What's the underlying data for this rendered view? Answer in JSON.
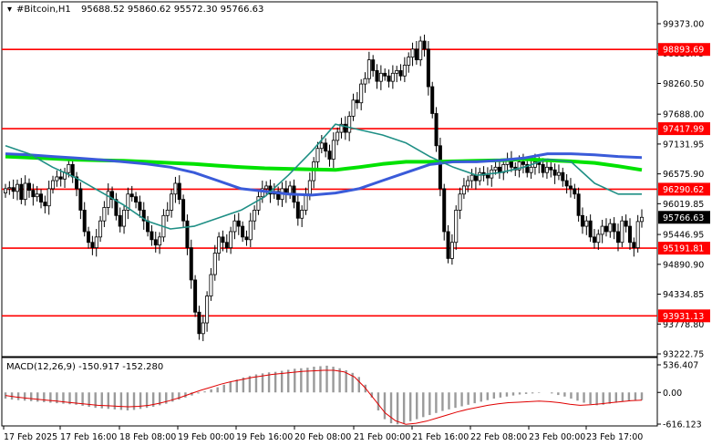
{
  "header": {
    "symbol": "#Bitcoin,H1",
    "ohlc": "95688.52 95860.62 95572.30 95766.63"
  },
  "chart_data": {
    "type": "candlestick",
    "symbol": "#Bitcoin",
    "timeframe": "H1",
    "price_axis": {
      "min": 93222.75,
      "max": 99373.0,
      "ticks": [
        99373.0,
        98816.75,
        98260.5,
        97688.0,
        97131.95,
        96575.9,
        96019.85,
        95446.95,
        94890.9,
        94334.85,
        93778.8,
        93222.75
      ]
    },
    "time_axis": {
      "labels": [
        "17 Feb 2025",
        "17 Feb 16:00",
        "18 Feb 08:00",
        "19 Feb 00:00",
        "19 Feb 16:00",
        "20 Feb 08:00",
        "21 Feb 00:00",
        "21 Feb 16:00",
        "22 Feb 08:00",
        "23 Feb 00:00",
        "23 Feb 17:00"
      ]
    },
    "levels": [
      {
        "price": 98893.69,
        "label": "98893.69",
        "color": "#ff0000"
      },
      {
        "price": 97417.99,
        "label": "97417.99",
        "color": "#ff0000"
      },
      {
        "price": 96290.62,
        "label": "96290.62",
        "color": "#ff0000"
      },
      {
        "price": 95191.81,
        "label": "95191.81",
        "color": "#ff0000"
      },
      {
        "price": 93931.13,
        "label": "93931.13",
        "color": "#ff0000"
      }
    ],
    "current_price": {
      "value": 95766.63,
      "label": "95766.63"
    },
    "candles_close": [
      96300,
      96320,
      96250,
      96380,
      96100,
      96400,
      96270,
      96150,
      96200,
      96050,
      95980,
      96300,
      96450,
      96520,
      96480,
      96600,
      96750,
      96520,
      96300,
      95900,
      95500,
      95300,
      95200,
      95400,
      95700,
      95950,
      96250,
      96100,
      95800,
      95600,
      95900,
      96200,
      96150,
      96050,
      95900,
      95700,
      95500,
      95350,
      95250,
      95400,
      95800,
      95900,
      96200,
      96400,
      96100,
      95700,
      95200,
      94600,
      94000,
      93600,
      93800,
      94300,
      94700,
      95100,
      95400,
      95300,
      95200,
      95500,
      95700,
      95600,
      95400,
      95350,
      95700,
      95900,
      96150,
      96300,
      96350,
      96200,
      96250,
      96100,
      96300,
      96200,
      96350,
      96050,
      95750,
      95900,
      96200,
      96450,
      96800,
      97050,
      97150,
      97000,
      96850,
      97200,
      97350,
      97500,
      97350,
      97650,
      97950,
      97900,
      98250,
      98350,
      98700,
      98500,
      98300,
      98450,
      98400,
      98300,
      98450,
      98500,
      98400,
      98600,
      98750,
      98900,
      98700,
      99050,
      98900,
      98200,
      97700,
      97100,
      96300,
      95500,
      95000,
      95300,
      95900,
      96200,
      96350,
      96450,
      96550,
      96450,
      96600,
      96550,
      96500,
      96650,
      96700,
      96600,
      96750,
      96850,
      96700,
      96650,
      96800,
      96750,
      96600,
      96700,
      96800,
      96750,
      96600,
      96700,
      96650,
      96550,
      96600,
      96450,
      96350,
      96300,
      96200,
      95800,
      95600,
      95700,
      95400,
      95300,
      95450,
      95600,
      95500,
      95650,
      95500,
      95300,
      95700,
      95600,
      95300,
      95200,
      95688.52,
      95766.63
    ],
    "moving_averages": [
      {
        "color": "#00e200",
        "points": [
          96900,
          96880,
          96860,
          96840,
          96830,
          96820,
          96800,
          96780,
          96760,
          96730,
          96700,
          96680,
          96670,
          96660,
          96650,
          96700,
          96760,
          96800,
          96800,
          96810,
          96820,
          96830,
          96850,
          96830,
          96810,
          96780,
          96720,
          96650
        ]
      },
      {
        "color": "#3a5bd9",
        "points": [
          96950,
          96930,
          96900,
          96870,
          96840,
          96800,
          96760,
          96700,
          96600,
          96450,
          96300,
          96250,
          96200,
          96180,
          96220,
          96300,
          96450,
          96600,
          96750,
          96800,
          96800,
          96830,
          96870,
          96950,
          96950,
          96930,
          96900,
          96880
        ]
      },
      {
        "color": "#1f8f85",
        "points": [
          97100,
          96950,
          96700,
          96500,
          96250,
          96000,
          95700,
          95550,
          95600,
          95750,
          95900,
          96150,
          96550,
          97000,
          97500,
          97400,
          97300,
          97150,
          96900,
          96700,
          96550,
          96600,
          96700,
          96850,
          96800,
          96400,
          96200,
          96200
        ]
      }
    ]
  },
  "macd": {
    "title": "MACD(12,26,9) -150.917 -152.280",
    "axis_labels": [
      "536.407",
      "0.00",
      "-616.123"
    ],
    "range": [
      -616.123,
      536.407
    ],
    "histogram": [
      -120,
      -140,
      -150,
      -160,
      -170,
      -180,
      -190,
      -200,
      -210,
      -220,
      -230,
      -240,
      -260,
      -280,
      -300,
      -310,
      -320,
      -330,
      -340,
      -350,
      -340,
      -320,
      -300,
      -280,
      -250,
      -220,
      -180,
      -140,
      -100,
      -60,
      -20,
      20,
      60,
      100,
      150,
      200,
      250,
      290,
      320,
      350,
      370,
      390,
      400,
      420,
      440,
      460,
      470,
      480,
      500,
      510,
      520,
      500,
      470,
      430,
      380,
      300,
      150,
      -100,
      -350,
      -520,
      -600,
      -620,
      -600,
      -560,
      -520,
      -480,
      -440,
      -400,
      -360,
      -330,
      -300,
      -270,
      -240,
      -210,
      -180,
      -150,
      -120,
      -100,
      -80,
      -60,
      -40,
      -30,
      -20,
      -10,
      0,
      -20,
      -50,
      -80,
      -120,
      -160,
      -200,
      -230,
      -250,
      -240,
      -220,
      -200,
      -180,
      -160,
      -150,
      -150
    ],
    "signal": [
      -60,
      -90,
      -110,
      -130,
      -150,
      -170,
      -190,
      -210,
      -230,
      -250,
      -260,
      -270,
      -280,
      -270,
      -250,
      -210,
      -160,
      -100,
      -30,
      40,
      100,
      160,
      210,
      250,
      290,
      320,
      350,
      370,
      390,
      410,
      420,
      430,
      430,
      400,
      300,
      100,
      -150,
      -400,
      -550,
      -620,
      -600,
      -560,
      -500,
      -440,
      -380,
      -330,
      -290,
      -250,
      -220,
      -200,
      -190,
      -180,
      -170,
      -180,
      -200,
      -230,
      -250,
      -240,
      -220,
      -200,
      -180,
      -160,
      -150
    ]
  }
}
